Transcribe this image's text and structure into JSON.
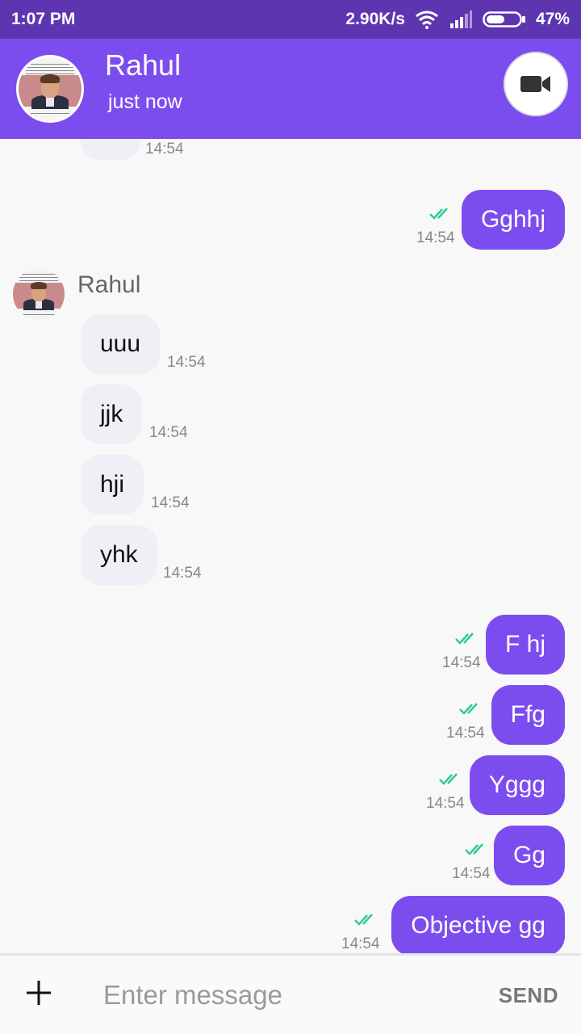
{
  "status_bar": {
    "time": "1:07 PM",
    "network_speed": "2.90K/s",
    "battery": "47%"
  },
  "header": {
    "contact_name": "Rahul",
    "presence": "just now"
  },
  "thread": {
    "sender_name": "Rahul",
    "messages": [
      {
        "direction": "incoming",
        "text": "",
        "time": "14:54"
      },
      {
        "direction": "outgoing",
        "text": "Gghhj",
        "time": "14:54",
        "status": "read"
      },
      {
        "direction": "incoming",
        "text": "uuu",
        "time": "14:54"
      },
      {
        "direction": "incoming",
        "text": "jjk",
        "time": "14:54"
      },
      {
        "direction": "incoming",
        "text": "hji",
        "time": "14:54"
      },
      {
        "direction": "incoming",
        "text": "yhk",
        "time": "14:54"
      },
      {
        "direction": "outgoing",
        "text": "F hj",
        "time": "14:54",
        "status": "read"
      },
      {
        "direction": "outgoing",
        "text": "Ffg",
        "time": "14:54",
        "status": "read"
      },
      {
        "direction": "outgoing",
        "text": "Yggg",
        "time": "14:54",
        "status": "read"
      },
      {
        "direction": "outgoing",
        "text": "Gg",
        "time": "14:54",
        "status": "read"
      },
      {
        "direction": "outgoing",
        "text": "Objective gg",
        "time": "14:54",
        "status": "read"
      }
    ]
  },
  "composer": {
    "placeholder": "Enter message",
    "value": "",
    "send_label": "SEND"
  },
  "colors": {
    "status_bar": "#5e35b1",
    "header": "#7c4dee",
    "outgoing_bubble": "#7c4dee",
    "incoming_bubble": "#eef0f5",
    "read_tick": "#2ecc8e"
  },
  "icons": [
    "wifi-icon",
    "signal-icon",
    "battery-icon",
    "video-call-icon",
    "double-check-icon",
    "plus-icon"
  ]
}
